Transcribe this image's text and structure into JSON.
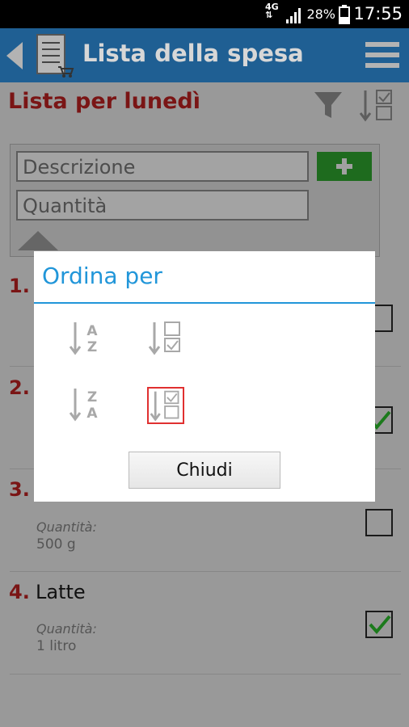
{
  "status_bar": {
    "network": "4G",
    "battery": "28%",
    "time": "17:55"
  },
  "app_bar": {
    "title": "Lista della spesa",
    "icons": [
      "back-icon",
      "shopping-list-icon",
      "menu-icon"
    ]
  },
  "list": {
    "title": "Lista per lunedì",
    "icons": [
      "filter-icon",
      "sort-checked-icon"
    ]
  },
  "add_form": {
    "description_placeholder": "Descrizione",
    "quantity_placeholder": "Quantità",
    "icons": [
      "plus-icon",
      "collapse-icon"
    ]
  },
  "items": [
    {
      "num": "1.",
      "name": "",
      "quantity_label": "",
      "quantity": "",
      "checked": false
    },
    {
      "num": "2.",
      "name": "",
      "quantity_label": "",
      "quantity": "",
      "checked": true
    },
    {
      "num": "3.",
      "name": "",
      "quantity_label": "Quantità:",
      "quantity": "500 g",
      "checked": false
    },
    {
      "num": "4.",
      "name": "Latte",
      "quantity_label": "Quantità:",
      "quantity": "1 litro",
      "checked": true
    }
  ],
  "dialog": {
    "title": "Ordina per",
    "options": [
      {
        "icon": "sort-az-icon",
        "selected": false
      },
      {
        "icon": "sort-unchecked-first-icon",
        "selected": false
      },
      {
        "icon": "sort-za-icon",
        "selected": false
      },
      {
        "icon": "sort-checked-first-icon",
        "selected": true
      }
    ],
    "close_label": "Chiudi"
  },
  "colors": {
    "appbar": "#1f5f93",
    "accent_red": "#7a1515",
    "dialog_title": "#2196d9",
    "add_green": "#1e6b1e",
    "selected_border": "#e03030",
    "check_green": "#1c7a1c"
  }
}
